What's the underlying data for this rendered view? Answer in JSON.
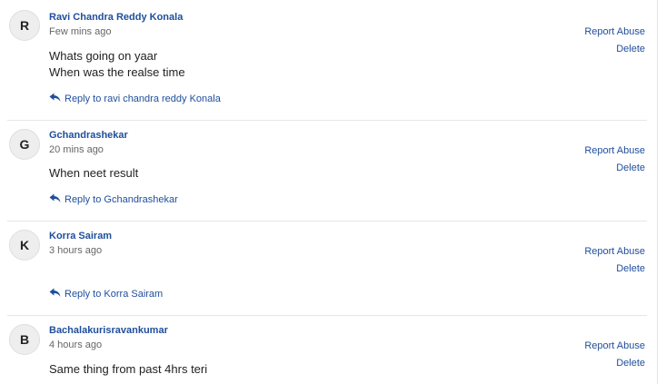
{
  "comments": [
    {
      "avatar_letter": "R",
      "author": "Ravi Chandra Reddy Konala",
      "time": "Few mins ago",
      "lines": [
        "Whats going on yaar",
        "When was the realse time"
      ],
      "reply_label": "Reply to ravi chandra reddy Konala",
      "report_label": "Report Abuse",
      "delete_label": "Delete"
    },
    {
      "avatar_letter": "G",
      "author": "Gchandrashekar",
      "time": "20 mins ago",
      "lines": [
        "When neet result"
      ],
      "reply_label": "Reply to Gchandrashekar",
      "report_label": "Report Abuse",
      "delete_label": "Delete"
    },
    {
      "avatar_letter": "K",
      "author": "Korra Sairam",
      "time": "3 hours ago",
      "lines": [],
      "reply_label": "Reply to Korra Sairam",
      "report_label": "Report Abuse",
      "delete_label": "Delete"
    },
    {
      "avatar_letter": "B",
      "author": "Bachalakurisravankumar",
      "time": "4 hours ago",
      "lines": [
        "Same thing from past 4hrs teri"
      ],
      "report_label": "Report Abuse",
      "delete_label": "Delete"
    }
  ],
  "colors": {
    "link": "#1f4e9c",
    "text": "#222222",
    "muted": "#666666",
    "avatar_bg": "#eeeeee",
    "divider": "#e6e6e6"
  },
  "icons": {
    "reply": "reply-arrow-icon"
  }
}
